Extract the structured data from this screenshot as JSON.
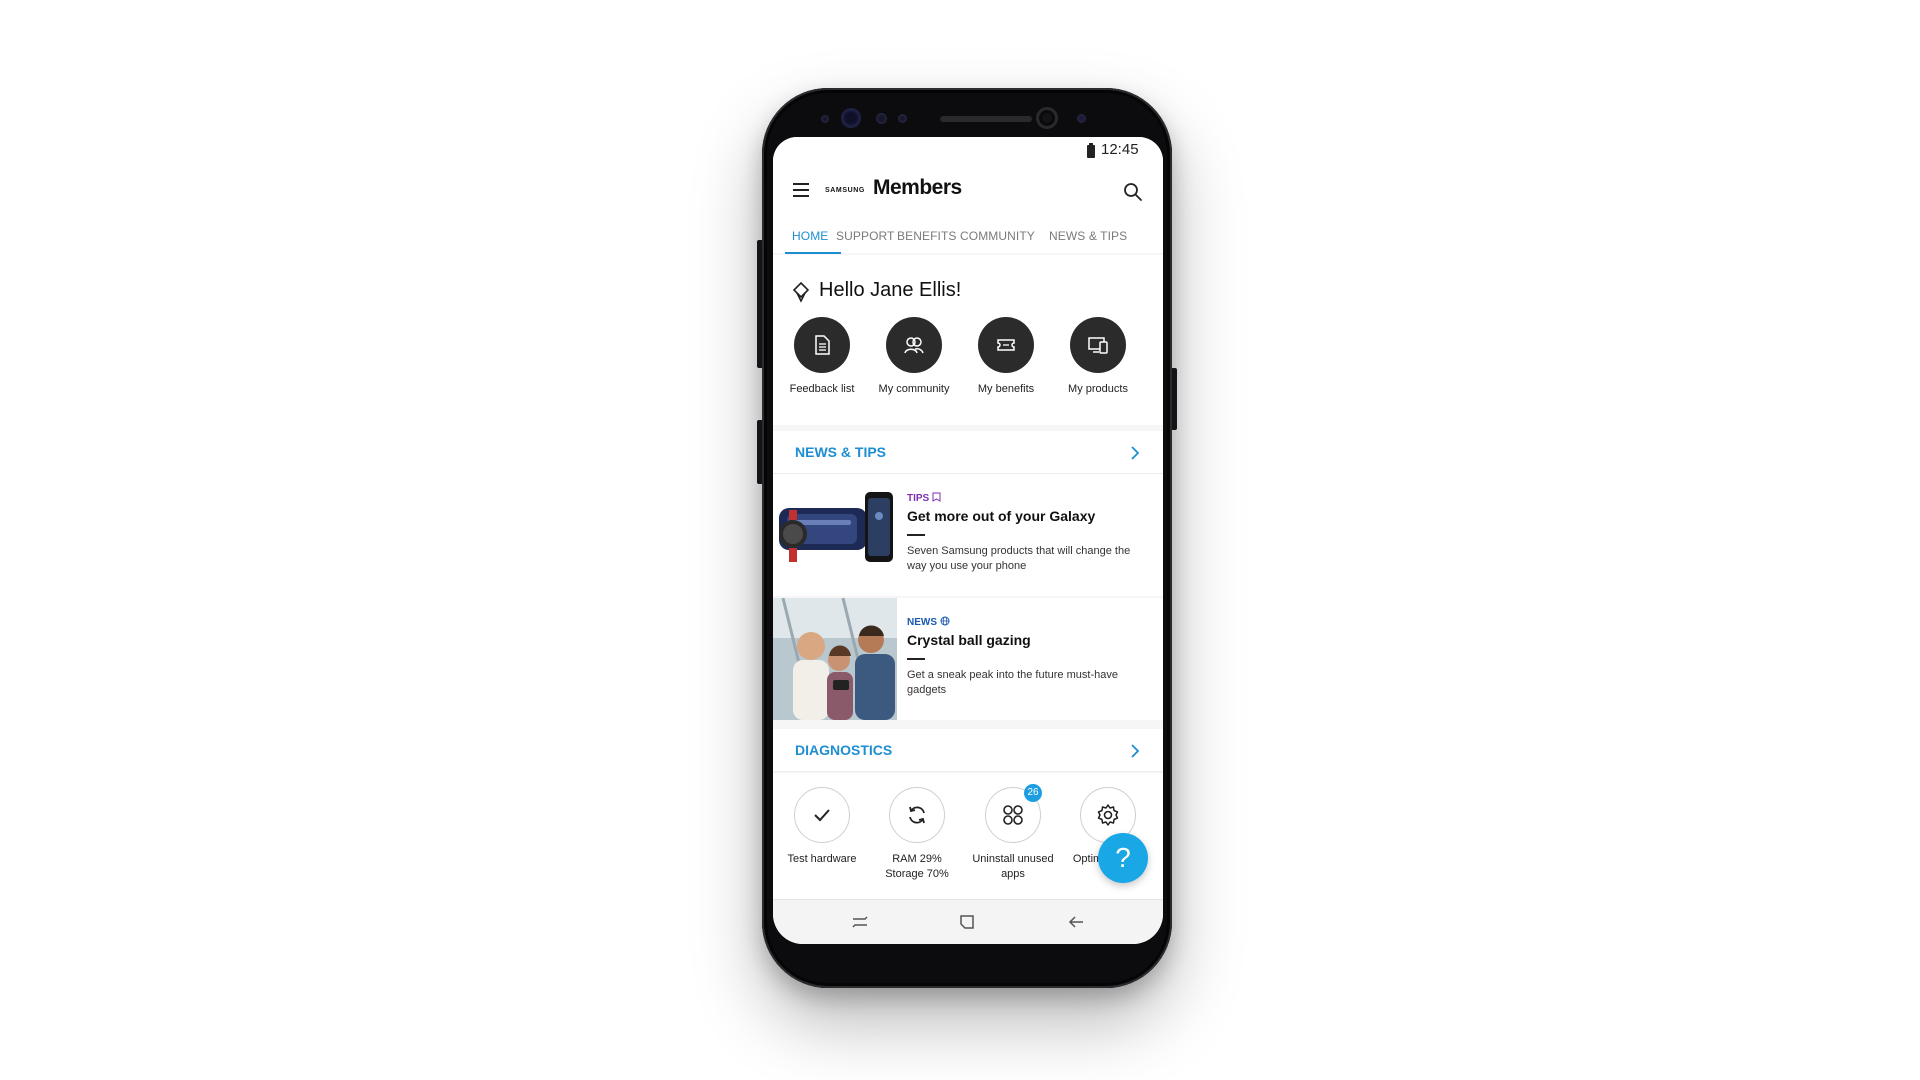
{
  "status_bar": {
    "time": "12:45"
  },
  "app": {
    "brand_small": "SAMSUNG",
    "brand_name": "Members"
  },
  "tabs": [
    {
      "label": "HOME",
      "active": true
    },
    {
      "label": "SUPPORT",
      "active": false
    },
    {
      "label": "BENEFITS",
      "active": false
    },
    {
      "label": "COMMUNITY",
      "active": false
    },
    {
      "label": "NEWS & TIPS",
      "active": false
    }
  ],
  "greeting": "Hello Jane Ellis!",
  "quick_actions": [
    {
      "label": "Feedback list",
      "icon": "document-icon"
    },
    {
      "label": "My community",
      "icon": "people-icon"
    },
    {
      "label": "My benefits",
      "icon": "ticket-icon"
    },
    {
      "label": "My products",
      "icon": "devices-icon"
    }
  ],
  "news_section": {
    "title": "NEWS & TIPS",
    "articles": [
      {
        "category": "TIPS",
        "category_icon": "bookmark-icon",
        "title": "Get more out of your Galaxy",
        "description": "Seven Samsung products that will change the way you use your phone"
      },
      {
        "category": "NEWS",
        "category_icon": "globe-icon",
        "title": "Crystal ball gazing",
        "description": "Get a sneak peak into the future must-have gadgets"
      }
    ]
  },
  "diagnostics_section": {
    "title": "DIAGNOSTICS",
    "items": [
      {
        "label": "Test hardware",
        "icon": "check-icon"
      },
      {
        "label_line1": "RAM  29%",
        "label_line2": "Storage  70%",
        "icon": "refresh-icon"
      },
      {
        "label_line1": "Uninstall unused",
        "label_line2": "apps",
        "icon": "apps-grid-icon",
        "badge": "26"
      },
      {
        "label": "Optimize apps",
        "icon": "gear-icon"
      }
    ]
  },
  "fab": {
    "label": "?"
  },
  "colors": {
    "accent": "#1d8fd1",
    "tips": "#7b2fb0",
    "news": "#1a58b0",
    "fab": "#1aa7e6"
  }
}
